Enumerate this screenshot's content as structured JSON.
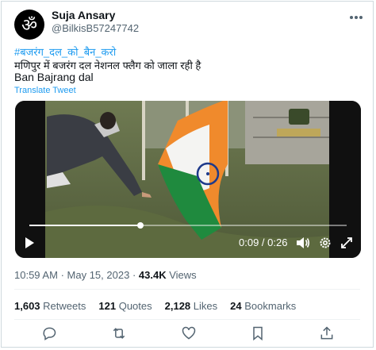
{
  "author": {
    "name": "Suja Ansary",
    "handle": "@BilkisB57247742"
  },
  "tweet": {
    "hashtag": "#बजरंग_दल_को_बैन_करो",
    "line1": "मणिपुर में बजरंग दल नेशनल फ्लैग को जाला रही है",
    "line2": "Ban Bajrang dal",
    "translate_label": "Translate Tweet"
  },
  "video": {
    "time_display": "0:09 / 0:26",
    "progress": 0.35
  },
  "meta": {
    "time": "10:59 AM",
    "separator": "·",
    "date": "May 15, 2023",
    "views_count": "43.4K",
    "views_label": "Views"
  },
  "stats": [
    {
      "count": "1,603",
      "label": "Retweets"
    },
    {
      "count": "121",
      "label": "Quotes"
    },
    {
      "count": "2,128",
      "label": "Likes"
    },
    {
      "count": "24",
      "label": "Bookmarks"
    }
  ],
  "icons": {
    "more": "more-icon",
    "reply": "reply-icon",
    "retweet": "retweet-icon",
    "like": "like-icon",
    "bookmark": "bookmark-icon",
    "share": "share-icon",
    "play": "play-icon",
    "volume": "volume-icon",
    "settings": "settings-icon",
    "fullscreen": "fullscreen-icon"
  },
  "colors": {
    "link": "#1d9bf0",
    "secondary_text": "#536471",
    "primary_text": "#0f1419"
  }
}
